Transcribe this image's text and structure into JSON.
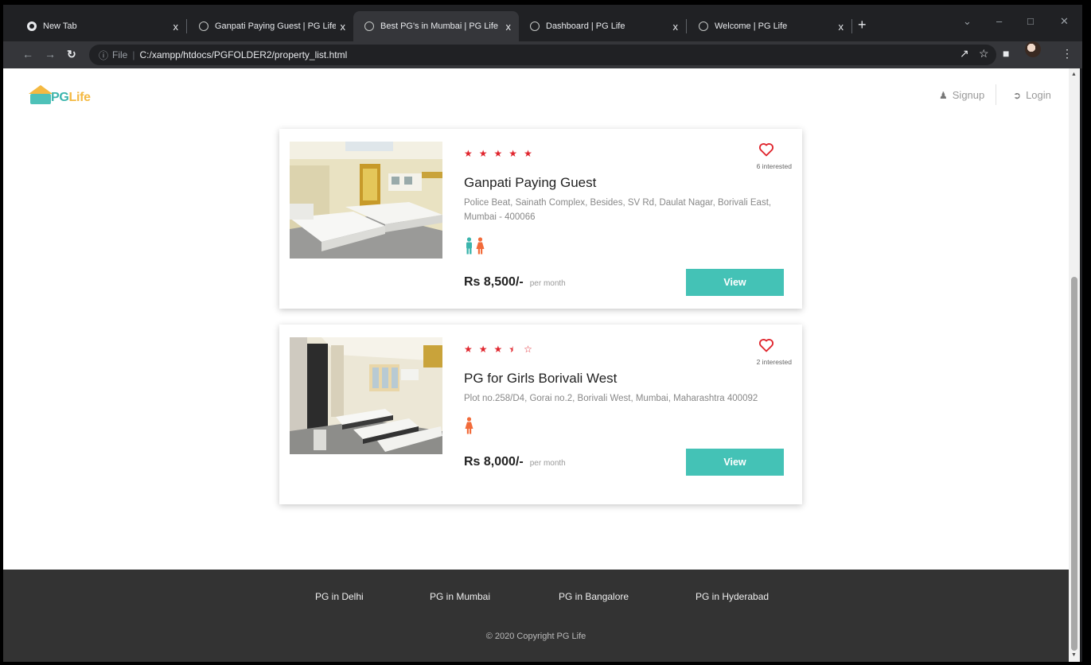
{
  "browser": {
    "tabs": [
      {
        "label": "New Tab",
        "close": "x"
      },
      {
        "label": "Ganpati Paying Guest | PG Life",
        "close": "x"
      },
      {
        "label": "Best PG's in Mumbai | PG Life",
        "close": "x"
      },
      {
        "label": "Dashboard | PG Life",
        "close": "x"
      },
      {
        "label": "Welcome | PG Life",
        "close": "x"
      }
    ],
    "address": {
      "scheme": "File",
      "url": "C:/xampp/htdocs/PGFOLDER2/property_list.html"
    }
  },
  "header": {
    "logo": {
      "part1": "PG",
      "part2": "Life"
    },
    "signup_label": "Signup",
    "login_label": "Login"
  },
  "properties": [
    {
      "name": "Ganpati Paying Guest",
      "address": "Police Beat, Sainath Complex, Besides, SV Rd, Daulat Nagar, Borivali East, Mumbai - 400066",
      "rating": 5,
      "interested": "6 interested",
      "gender": "unisex",
      "price": "Rs 8,500/-",
      "price_unit": "per month",
      "view_label": "View"
    },
    {
      "name": "PG for Girls Borivali West",
      "address": "Plot no.258/D4, Gorai no.2, Borivali West, Mumbai, Maharashtra 400092",
      "rating": 3.5,
      "interested": "2 interested",
      "gender": "female",
      "price": "Rs 8,000/-",
      "price_unit": "per month",
      "view_label": "View"
    }
  ],
  "footer": {
    "links": [
      "PG in Delhi",
      "PG in Mumbai",
      "PG in Bangalore",
      "PG in Hyderabad"
    ],
    "copyright": "© 2020 Copyright PG Life"
  },
  "colors": {
    "accent": "#44c2b6",
    "star": "#e0262e",
    "logo_yellow": "#f4b942",
    "male_icon": "#3cb5ad",
    "female_icon": "#f26b3a",
    "footer_bg": "#333333"
  }
}
